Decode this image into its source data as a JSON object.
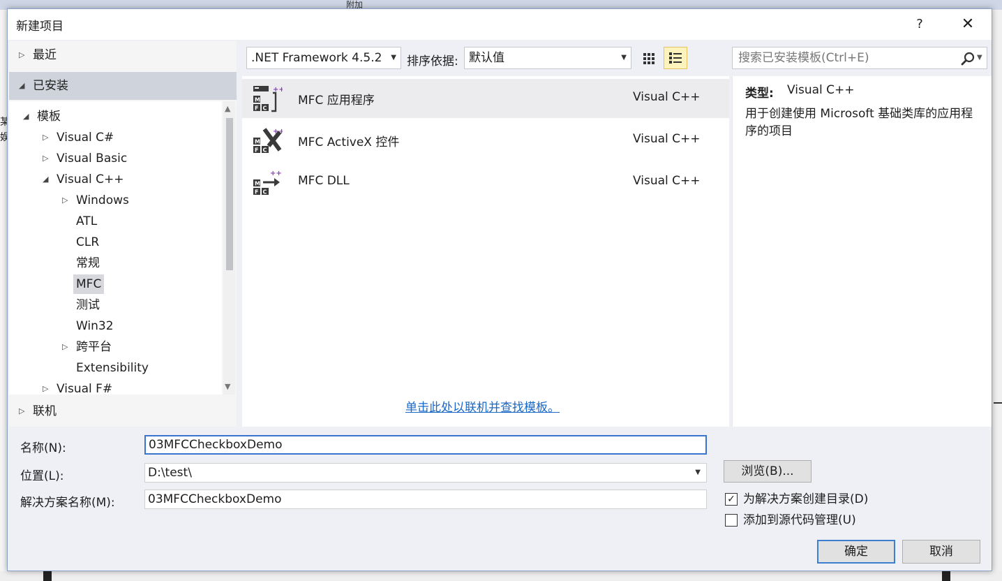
{
  "ide": {
    "toolbar_attach_label": "附加",
    "left_fragment_1": "某",
    "left_fragment_2": "娱"
  },
  "dialog": {
    "title": "新建项目",
    "help_label": "?",
    "close_label": "✕"
  },
  "nav": {
    "recent": "最近",
    "installed": "已安装",
    "online": "联机",
    "tree": {
      "templates": "模板",
      "visual_csharp": "Visual C#",
      "visual_basic": "Visual Basic",
      "visual_cpp": "Visual C++",
      "windows": "Windows",
      "atl": "ATL",
      "clr": "CLR",
      "general": "常规",
      "mfc": "MFC",
      "test": "测试",
      "win32": "Win32",
      "cross_platform": "跨平台",
      "extensibility": "Extensibility",
      "visual_fsharp": "Visual F#"
    }
  },
  "filters": {
    "framework": ".NET Framework 4.5.2",
    "sort_label": "排序依据:",
    "sort_value": "默认值",
    "search_placeholder": "搜索已安装模板(Ctrl+E)"
  },
  "templates": [
    {
      "name": "MFC 应用程序",
      "lang": "Visual C++"
    },
    {
      "name": "MFC ActiveX 控件",
      "lang": "Visual C++"
    },
    {
      "name": "MFC DLL",
      "lang": "Visual C++"
    }
  ],
  "online_link": "单击此处以联机并查找模板。",
  "description": {
    "type_label": "类型:",
    "type_value": "Visual C++",
    "text": "用于创建使用 Microsoft 基础类库的应用程序的项目"
  },
  "form": {
    "name_label": "名称(N):",
    "name_value": "03MFCCheckboxDemo",
    "location_label": "位置(L):",
    "location_value": "D:\\test\\",
    "solution_label": "解决方案名称(M):",
    "solution_value": "03MFCCheckboxDemo",
    "browse_label": "浏览(B)...",
    "create_dir_label": "为解决方案创建目录(D)",
    "create_dir_checked": true,
    "source_control_label": "添加到源代码管理(U)",
    "source_control_checked": false,
    "ok_label": "确定",
    "cancel_label": "取消"
  }
}
